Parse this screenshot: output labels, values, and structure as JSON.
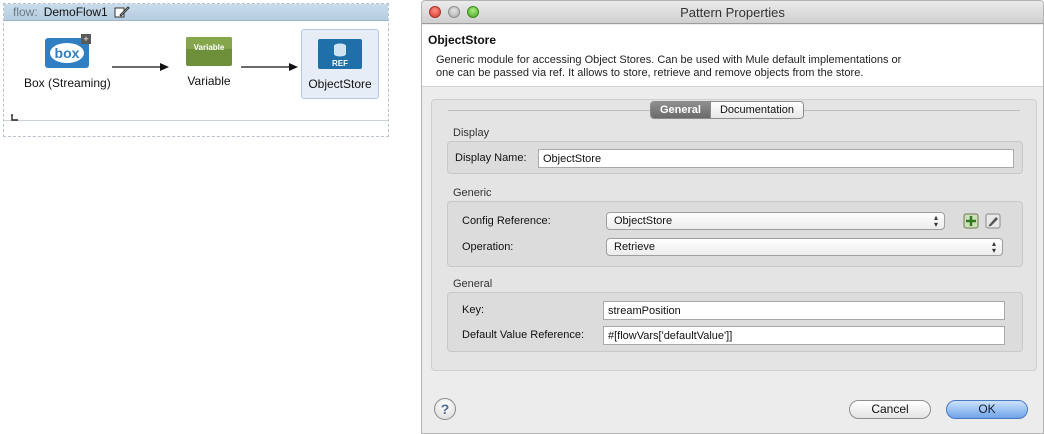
{
  "flow": {
    "keyword": "flow:",
    "name": "DemoFlow1",
    "nodes": [
      {
        "label": "Box (Streaming)",
        "icon": "box-connector-icon"
      },
      {
        "label": "Variable",
        "icon": "variable-transformer-icon",
        "icon_text": "Variable"
      },
      {
        "label": "ObjectStore",
        "icon": "objectstore-icon",
        "icon_text": "REF"
      }
    ]
  },
  "dialog": {
    "title": "Pattern Properties",
    "heading": "ObjectStore",
    "description_line1": "Generic module for accessing Object Stores.  Can be used with Mule default implementations or",
    "description_line2": "one can be passed via ref. It allows to store, retrieve and remove objects from the store.",
    "tabs": [
      {
        "label": "General",
        "active": true
      },
      {
        "label": "Documentation",
        "active": false
      }
    ],
    "sections": {
      "display": {
        "title": "Display",
        "display_name_label": "Display Name:",
        "display_name_value": "ObjectStore"
      },
      "generic": {
        "title": "Generic",
        "config_reference_label": "Config Reference:",
        "config_reference_value": "ObjectStore",
        "operation_label": "Operation:",
        "operation_value": "Retrieve"
      },
      "general": {
        "title": "General",
        "key_label": "Key:",
        "key_value": "streamPosition",
        "default_value_label": "Default Value Reference:",
        "default_value_value": "#[flowVars['defaultValue']]"
      }
    },
    "buttons": {
      "help": "?",
      "cancel": "Cancel",
      "ok": "OK"
    }
  },
  "colors": {
    "flow_header": "#b5cde0",
    "variable_green": "#6e8f3a",
    "objectstore_blue": "#1f6fa8",
    "ok_button": "#6ea4ea"
  }
}
